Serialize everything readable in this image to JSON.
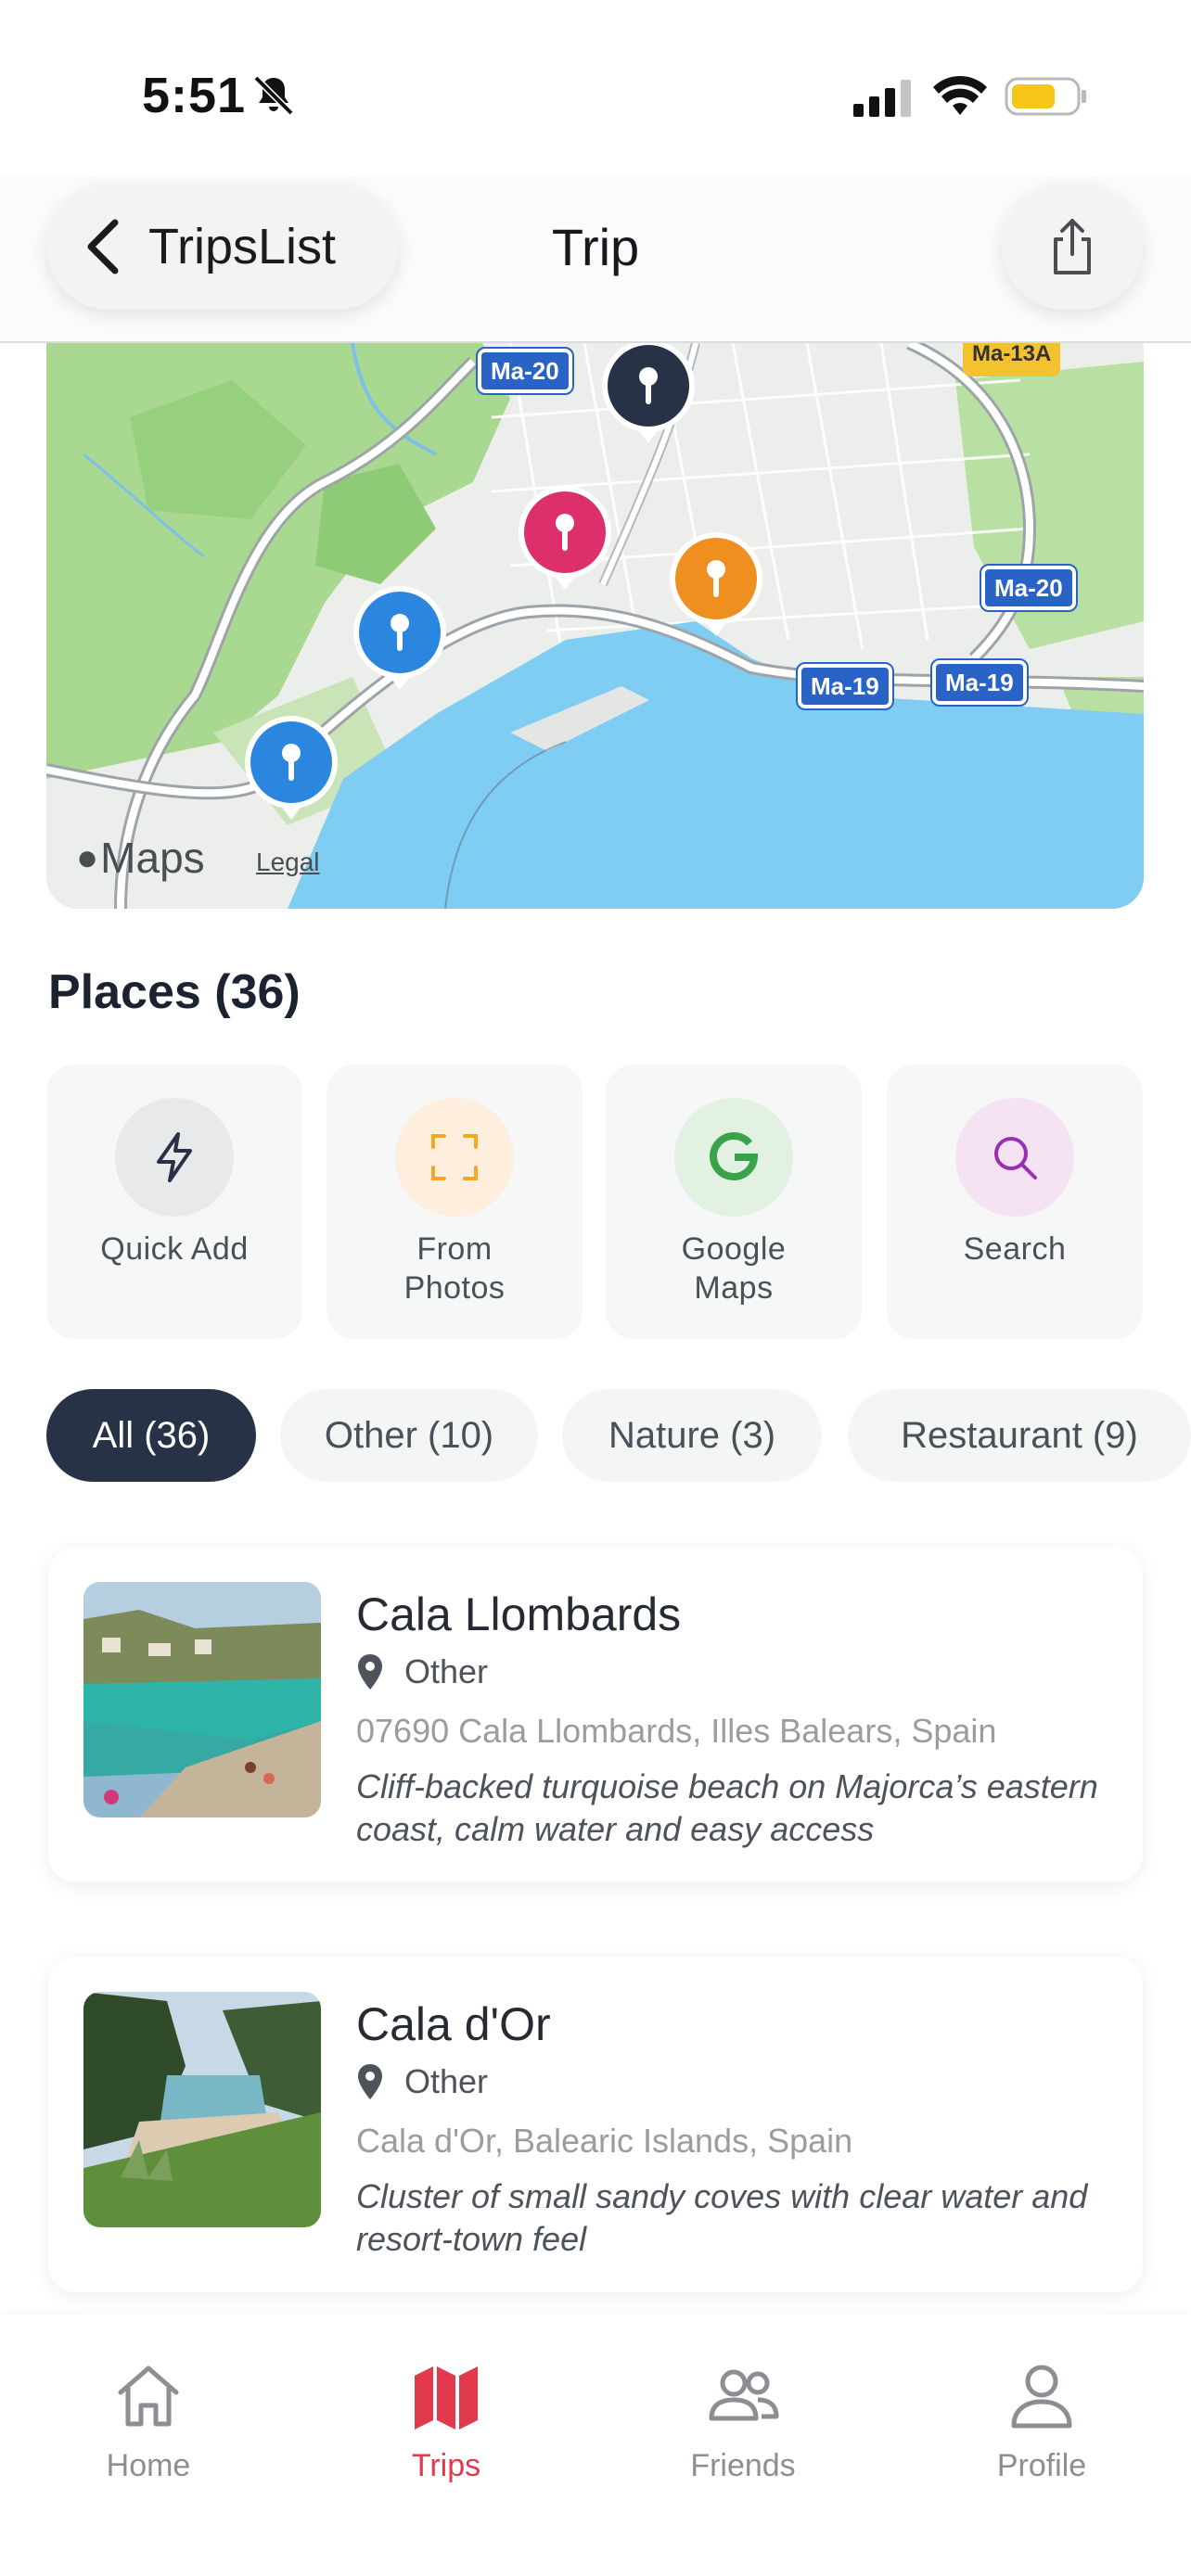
{
  "status_bar": {
    "time": "5:51"
  },
  "nav": {
    "back_label": "TripsList",
    "title": "Trip"
  },
  "map": {
    "roads": [
      "Ma-20",
      "Ma-13A",
      "Ma-20",
      "Ma-19",
      "Ma-19"
    ],
    "logo": "Maps",
    "legal": "Legal"
  },
  "places": {
    "title": "Places (36)",
    "actions": [
      {
        "label": "Quick Add",
        "icon": "lightning-icon",
        "color": "#273246"
      },
      {
        "label": "From Photos",
        "icon": "scan-icon",
        "color": "#f5a623"
      },
      {
        "label": "Google Maps",
        "icon": "google-icon",
        "color": "#3aa34a"
      },
      {
        "label": "Search",
        "icon": "search-icon",
        "color": "#9b2fb0"
      }
    ],
    "filters": [
      "All (36)",
      "Other (10)",
      "Nature (3)",
      "Restaurant (9)"
    ],
    "items": [
      {
        "name": "Cala Llombards",
        "category": "Other",
        "address": "07690 Cala Llombards, Illes Balears, Spain",
        "description": "Cliff-backed turquoise beach on Majorca’s eastern coast, calm water and easy access"
      },
      {
        "name": "Cala d'Or",
        "category": "Other",
        "address": "Cala d'Or, Balearic Islands, Spain",
        "description": "Cluster of small sandy coves with clear water and resort-town feel"
      }
    ]
  },
  "tabbar": {
    "items": [
      {
        "label": "Home",
        "icon": "home-icon"
      },
      {
        "label": "Trips",
        "icon": "map-icon"
      },
      {
        "label": "Friends",
        "icon": "friends-icon"
      },
      {
        "label": "Profile",
        "icon": "profile-icon"
      }
    ],
    "active": "Trips",
    "accent": "#e23a4c"
  }
}
